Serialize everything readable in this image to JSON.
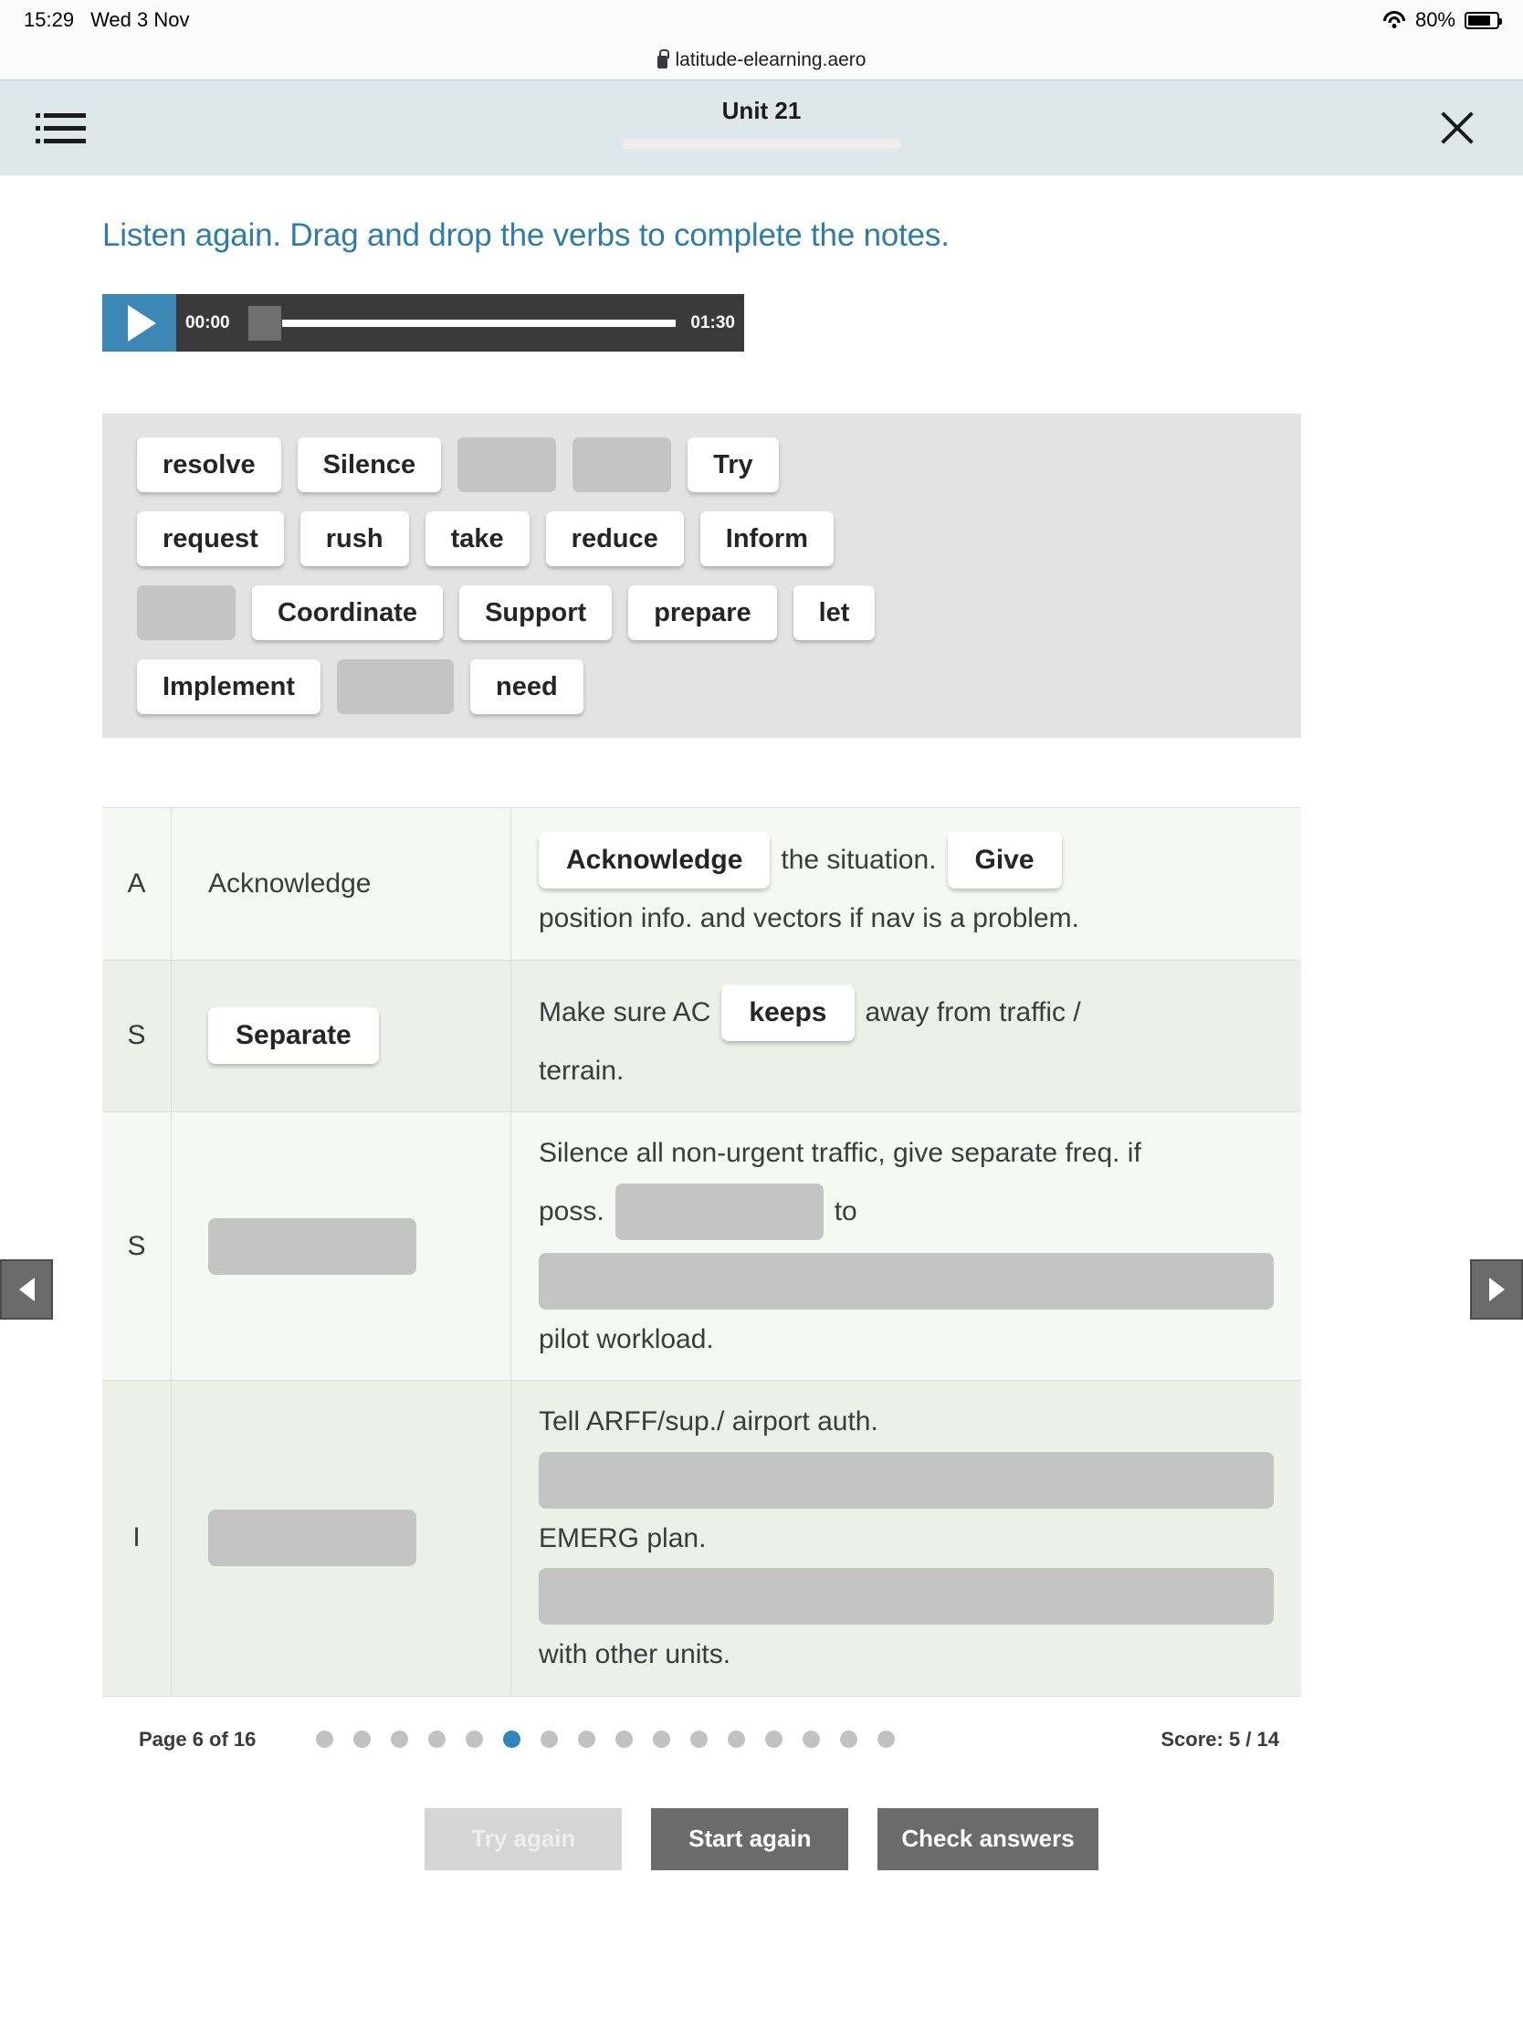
{
  "status_bar": {
    "time": "15:29",
    "date": "Wed 3 Nov",
    "battery_percent": "80%",
    "wifi_icon": "wifi-icon",
    "battery_icon": "battery-icon"
  },
  "browser": {
    "url": "latitude-elearning.aero",
    "lock_icon": "lock-icon"
  },
  "app_header": {
    "title": "Unit 21",
    "menu_icon": "hamburger-menu-icon",
    "close_icon": "close-icon"
  },
  "instruction": "Listen again. Drag and drop the verbs to complete the notes.",
  "audio": {
    "play_icon": "play-icon",
    "current_time": "00:00",
    "duration": "01:30"
  },
  "word_bank": {
    "rows": [
      [
        {
          "label": "resolve",
          "blank": false,
          "width": 0
        },
        {
          "label": "Silence",
          "blank": false,
          "width": 0
        },
        {
          "label": "",
          "blank": true,
          "width": 108
        },
        {
          "label": "",
          "blank": true,
          "width": 108
        },
        {
          "label": "Try",
          "blank": false,
          "width": 0
        }
      ],
      [
        {
          "label": "request",
          "blank": false,
          "width": 0
        },
        {
          "label": "rush",
          "blank": false,
          "width": 0
        },
        {
          "label": "take",
          "blank": false,
          "width": 0
        },
        {
          "label": "reduce",
          "blank": false,
          "width": 0
        },
        {
          "label": "Inform",
          "blank": false,
          "width": 0
        }
      ],
      [
        {
          "label": "",
          "blank": true,
          "width": 108
        },
        {
          "label": "Coordinate",
          "blank": false,
          "width": 0
        },
        {
          "label": "Support",
          "blank": false,
          "width": 0
        },
        {
          "label": "prepare",
          "blank": false,
          "width": 0
        },
        {
          "label": "let",
          "blank": false,
          "width": 0
        }
      ],
      [
        {
          "label": "Implement",
          "blank": false,
          "width": 0
        },
        {
          "label": "",
          "blank": true,
          "width": 128
        },
        {
          "label": "need",
          "blank": false,
          "width": 0
        }
      ]
    ]
  },
  "notes_table": {
    "rows": [
      {
        "letter": "A",
        "verb_text": "Acknowledge",
        "verb_blank": false,
        "note_parts": [
          {
            "type": "placed",
            "text": "Acknowledge"
          },
          {
            "type": "text",
            "text": "the situation."
          },
          {
            "type": "placed",
            "text": "Give"
          },
          {
            "type": "text",
            "text": "position info. and vectors if nav is a problem.",
            "newline": true
          }
        ]
      },
      {
        "letter": "S",
        "verb_text": "Separate",
        "verb_blank": false,
        "verb_placed": true,
        "note_parts": [
          {
            "type": "text",
            "text": "Make sure AC"
          },
          {
            "type": "placed",
            "text": "keeps"
          },
          {
            "type": "text",
            "text": "away from traffic /"
          },
          {
            "type": "text",
            "text": "terrain.",
            "newline": true
          }
        ]
      },
      {
        "letter": "S",
        "verb_text": "",
        "verb_blank": true,
        "note_parts": [
          {
            "type": "text",
            "text": "Silence all non-urgent traffic, give separate freq. if",
            "newline": true
          },
          {
            "type": "text",
            "text": "poss."
          },
          {
            "type": "drop",
            "text": ""
          },
          {
            "type": "text",
            "text": "to"
          },
          {
            "type": "drop",
            "text": "",
            "newline": true
          },
          {
            "type": "text",
            "text": "pilot workload."
          }
        ]
      },
      {
        "letter": "I",
        "verb_text": "",
        "verb_blank": true,
        "note_parts": [
          {
            "type": "text",
            "text": "Tell ARFF/sup./ airport auth.",
            "newline": true
          },
          {
            "type": "drop",
            "text": "",
            "newline": true
          },
          {
            "type": "text",
            "text": "EMERG plan."
          },
          {
            "type": "drop",
            "text": "",
            "newline": true
          },
          {
            "type": "text",
            "text": "with other units."
          }
        ]
      }
    ]
  },
  "pager": {
    "label": "Page 6 of 16",
    "total_dots": 16,
    "active_index": 6,
    "score": "Score: 5 / 14"
  },
  "buttons": {
    "try_again": "Try again",
    "start_again": "Start again",
    "check_answers": "Check answers"
  },
  "side_nav": {
    "prev_icon": "previous-arrow-icon",
    "next_icon": "next-arrow-icon"
  },
  "colors": {
    "accent_blue": "#2f7ca8",
    "header_bg": "#dde7ec",
    "play_btn": "#3d87b4",
    "dot_active": "#2f86bd"
  }
}
